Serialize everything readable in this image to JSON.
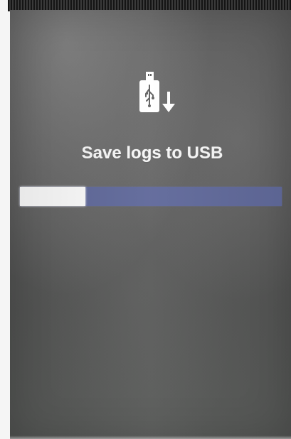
{
  "screen": {
    "title": "Save logs to USB",
    "icon": "usb-download-icon"
  },
  "progress": {
    "fraction": 0.25,
    "fill_color": "#fbfbfb",
    "track_color": "#616a9b"
  },
  "colors": {
    "screen_background": "#5a5b5a",
    "text": "#f7f7f7"
  }
}
